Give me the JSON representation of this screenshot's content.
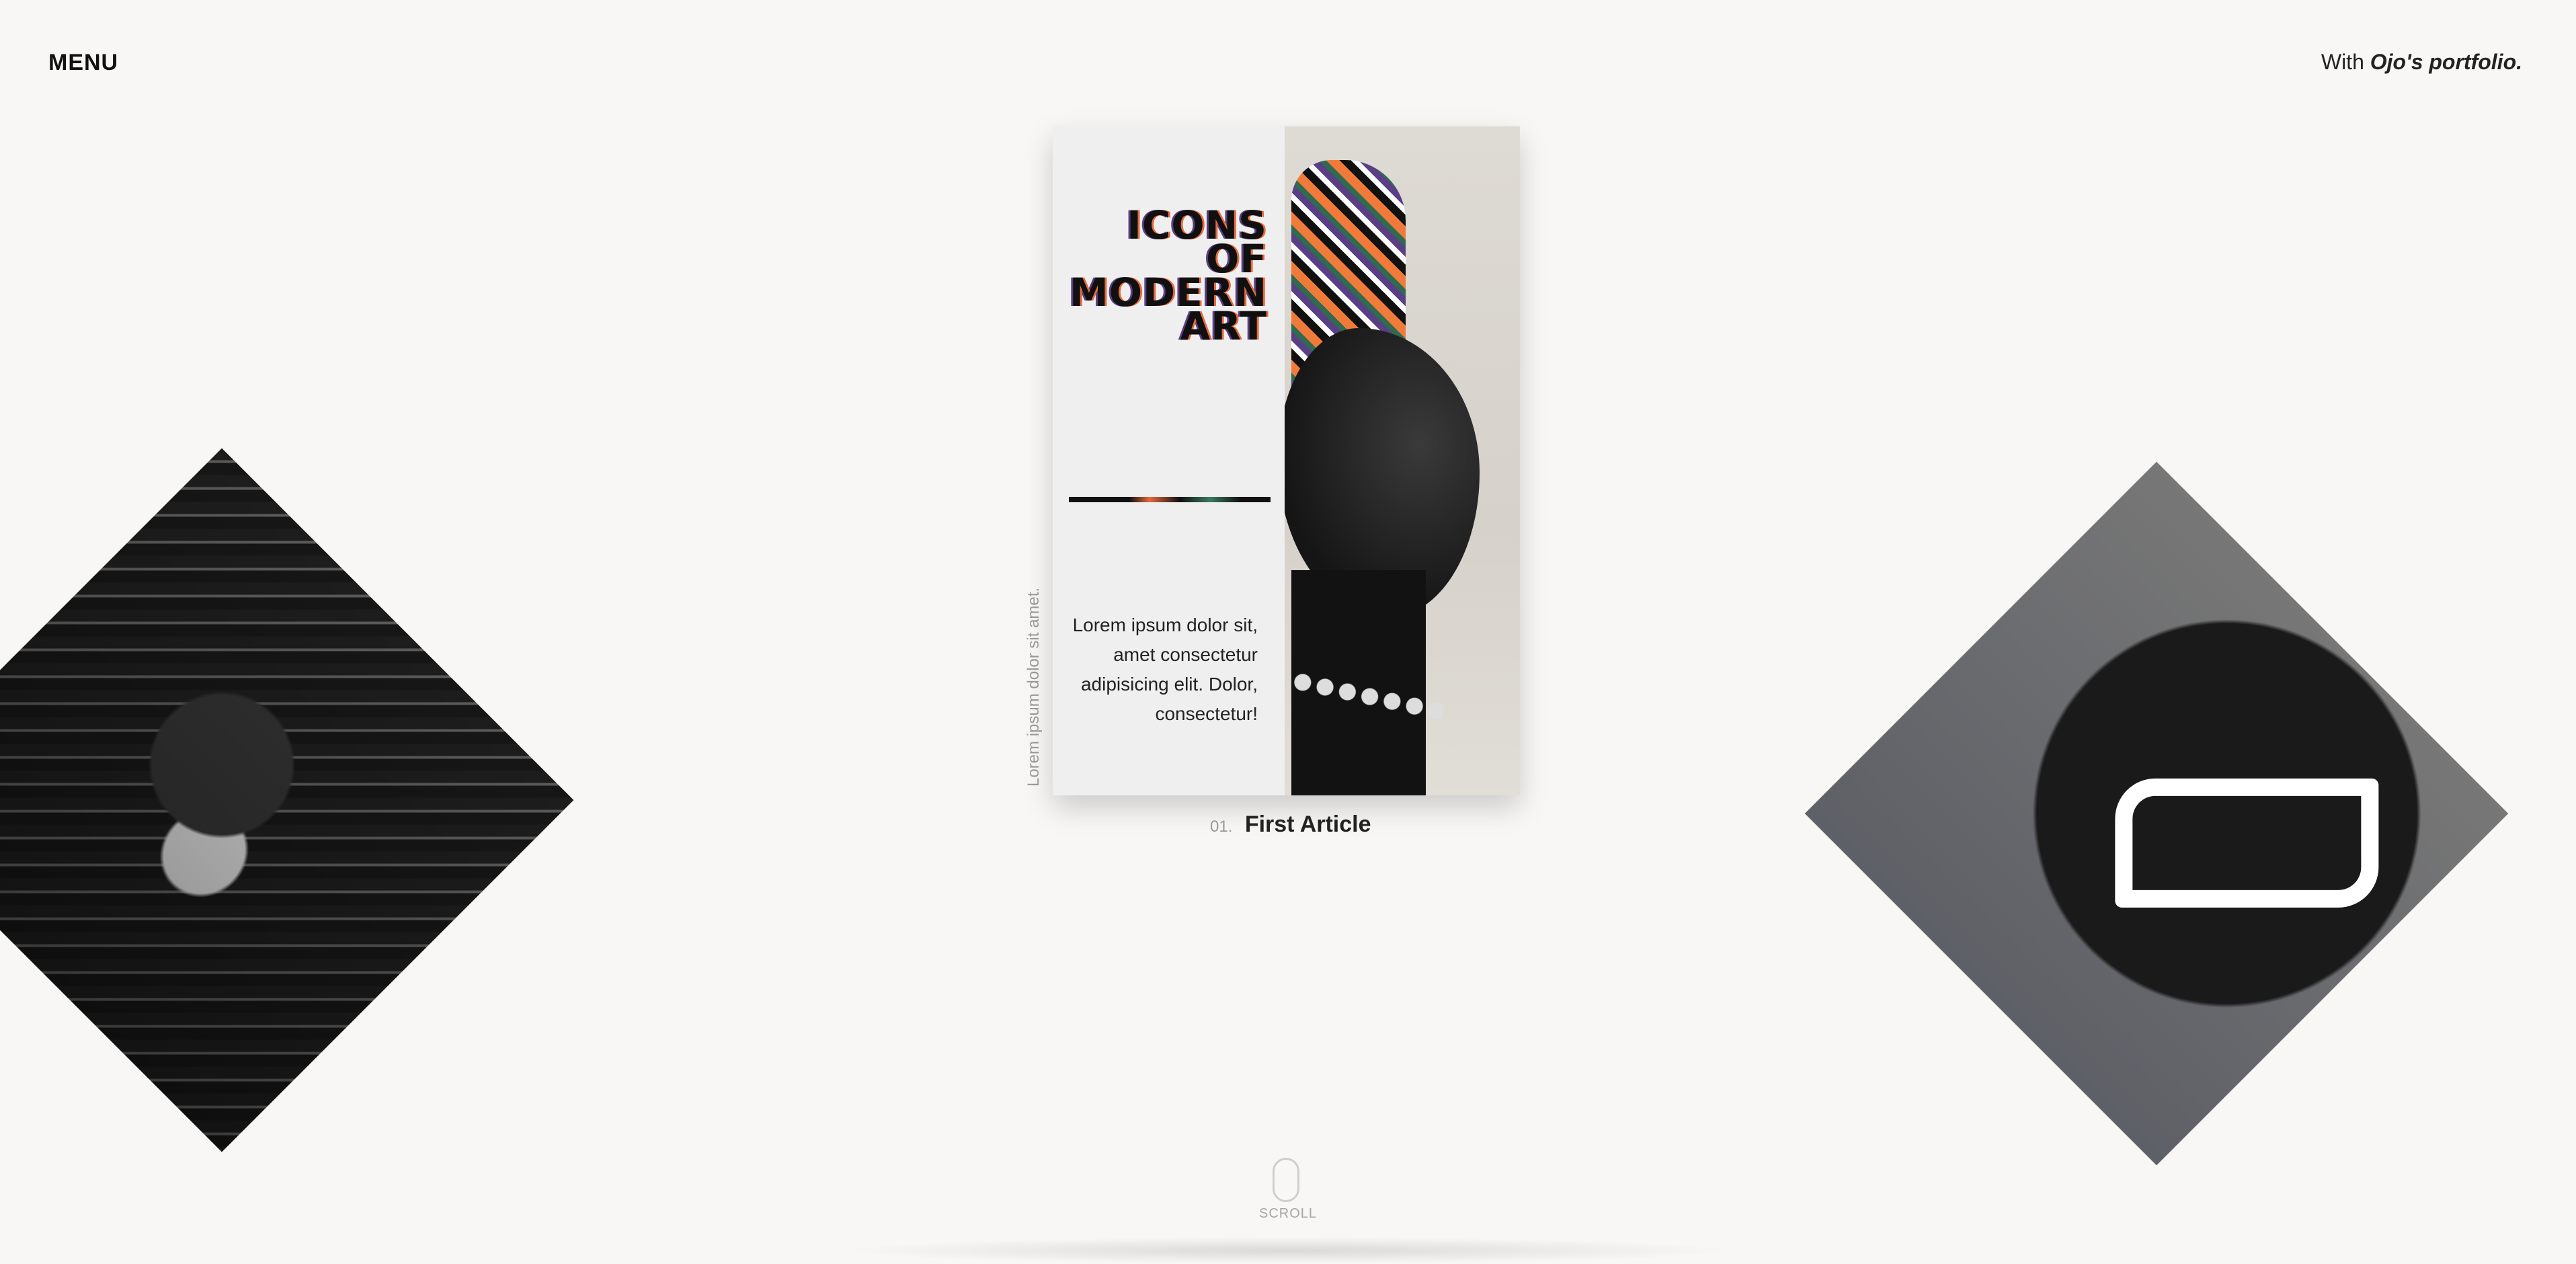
{
  "header": {
    "menu_label": "MENU",
    "credit_prefix": "With",
    "credit_name": "Ojo's portfolio."
  },
  "card": {
    "title_lines": [
      "ICONS",
      "OF",
      "MODERN",
      "ART"
    ],
    "description": "Lorem ipsum dolor sit, amet consectetur adipisicing elit. Dolor, consectetur!",
    "side_caption": "Lorem ipsum dolor sit amet.",
    "number": "01.",
    "label": "First Article"
  },
  "scroll": {
    "label": "SCROLL"
  },
  "colors": {
    "background": "#f8f7f5",
    "accent_orange": "#e46a3c",
    "accent_purple": "#5b3e82"
  }
}
